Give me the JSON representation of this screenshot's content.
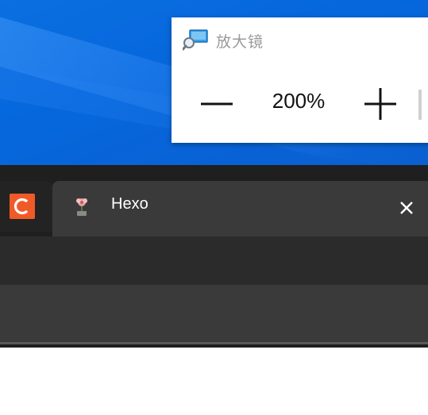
{
  "magnifier": {
    "title": "放大镜",
    "zoom_level": "200%",
    "icon": "magnifier-app-icon",
    "zoom_out_icon": "minus-icon",
    "zoom_in_icon": "plus-icon"
  },
  "browser": {
    "pinned_tab_icon": "c-logo-icon",
    "active_tab": {
      "title": "Hexo",
      "favicon": "hexo-favicon-icon",
      "close_icon": "close-icon"
    }
  },
  "colors": {
    "desktop_blue": "#0667dd",
    "browser_dark": "#1f1f1f",
    "tab_active": "#3a3a3a",
    "logo_orange": "#f05a28"
  }
}
